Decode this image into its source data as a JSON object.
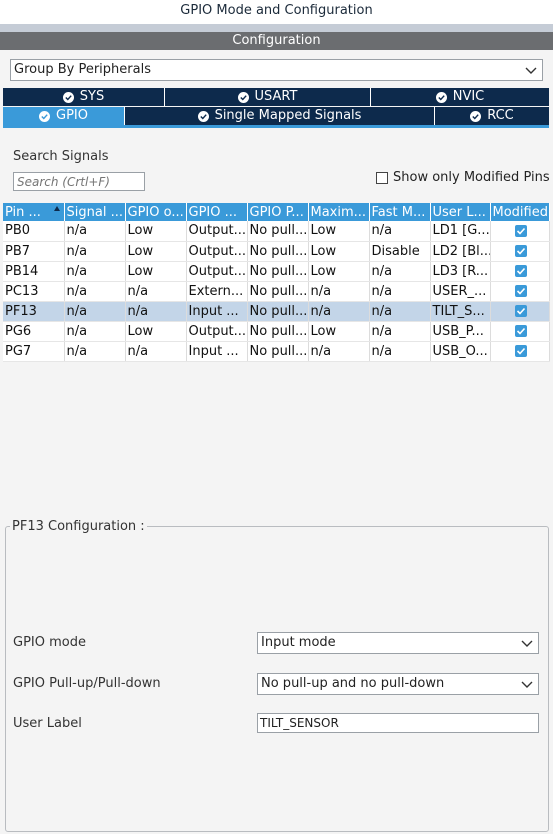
{
  "window": {
    "title": "GPIO Mode and Configuration",
    "section_header": "Configuration"
  },
  "group_by": {
    "selected": "Group By Peripherals"
  },
  "tabs_row1": [
    {
      "label": "SYS",
      "checked": true
    },
    {
      "label": "USART",
      "checked": true
    },
    {
      "label": "NVIC",
      "checked": true
    }
  ],
  "tabs_row2": [
    {
      "label": "GPIO",
      "checked": true,
      "active": true
    },
    {
      "label": "Single Mapped Signals",
      "checked": true
    },
    {
      "label": "RCC",
      "checked": true
    }
  ],
  "search": {
    "label": "Search Signals",
    "placeholder": "Search (Crtl+F)",
    "show_modified_label": "Show only Modified Pins",
    "show_modified_checked": false
  },
  "table": {
    "columns": [
      "Pin ...",
      "Signal ...",
      "GPIO o...",
      "GPIO ...",
      "GPIO P...",
      "Maxim...",
      "Fast M...",
      "User L...",
      "Modified"
    ],
    "rows": [
      [
        "PB0",
        "n/a",
        "Low",
        "Output...",
        "No pull...",
        "Low",
        "n/a",
        "LD1 [G..."
      ],
      [
        "PB7",
        "n/a",
        "Low",
        "Output...",
        "No pull...",
        "Low",
        "Disable",
        "LD2 [Bl..."
      ],
      [
        "PB14",
        "n/a",
        "Low",
        "Output...",
        "No pull...",
        "Low",
        "n/a",
        "LD3 [R..."
      ],
      [
        "PC13",
        "n/a",
        "n/a",
        "Extern...",
        "No pull...",
        "n/a",
        "n/a",
        "USER_..."
      ],
      [
        "PF13",
        "n/a",
        "n/a",
        "Input ...",
        "No pull...",
        "n/a",
        "n/a",
        "TILT_S..."
      ],
      [
        "PG6",
        "n/a",
        "Low",
        "Output...",
        "No pull...",
        "Low",
        "n/a",
        "USB_P..."
      ],
      [
        "PG7",
        "n/a",
        "n/a",
        "Input ...",
        "No pull...",
        "n/a",
        "n/a",
        "USB_O..."
      ]
    ],
    "selected_row": 4
  },
  "config": {
    "legend": "PF13 Configuration :",
    "gpio_mode_label": "GPIO mode",
    "gpio_mode_value": "Input mode",
    "pull_label": "GPIO Pull-up/Pull-down",
    "pull_value": "No pull-up and no pull-down",
    "user_label_label": "User Label",
    "user_label_value": "TILT_SENSOR"
  },
  "colors": {
    "accent": "#3a9ad9",
    "tab_dark": "#0d2a4c",
    "selected_row": "#c3d5e8"
  }
}
